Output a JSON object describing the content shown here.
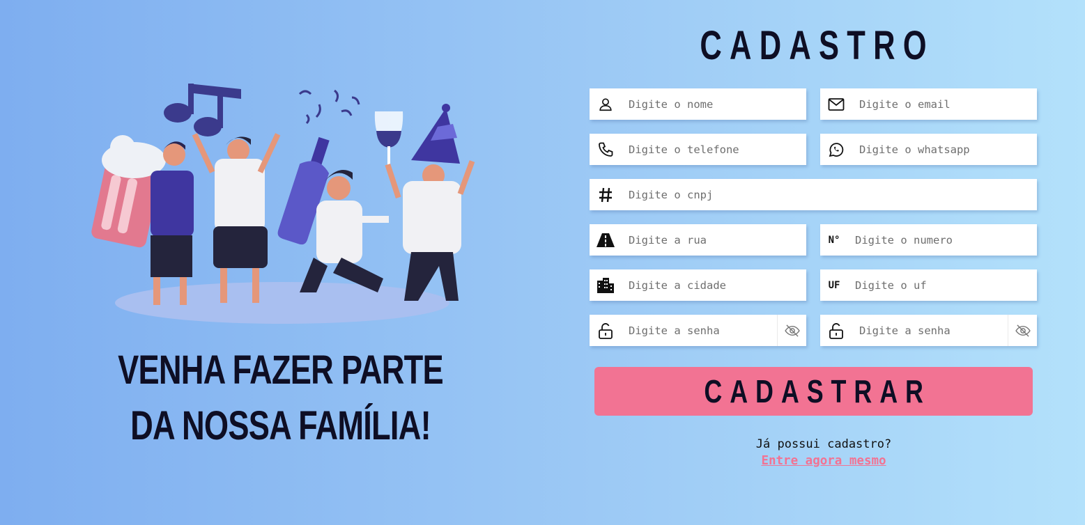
{
  "hero": {
    "tagline": "VENHA FAZER PARTE DA NOSSA FAMÍLIA!",
    "illustration_icon": "party-people-illustration"
  },
  "form": {
    "title": "CADASTRO",
    "fields": {
      "nome": {
        "placeholder": "Digite o nome",
        "icon": "user-icon"
      },
      "email": {
        "placeholder": "Digite o email",
        "icon": "mail-icon"
      },
      "telefone": {
        "placeholder": "Digite o telefone",
        "icon": "phone-icon"
      },
      "whatsapp": {
        "placeholder": "Digite o whatsapp",
        "icon": "whatsapp-icon"
      },
      "cnpj": {
        "placeholder": "Digite o cnpj",
        "icon": "hash-icon"
      },
      "rua": {
        "placeholder": "Digite a rua",
        "icon": "road-icon"
      },
      "numero": {
        "placeholder": "Digite o numero",
        "prefix": "N°"
      },
      "cidade": {
        "placeholder": "Digite a cidade",
        "icon": "city-icon"
      },
      "uf": {
        "placeholder": "Digite o uf",
        "prefix": "UF"
      },
      "senha": {
        "placeholder": "Digite a senha",
        "icon": "unlock-icon",
        "toggle_icon": "eye-off-icon"
      },
      "confirmar_senha": {
        "placeholder": "Digite a senha",
        "icon": "unlock-icon",
        "toggle_icon": "eye-off-icon"
      }
    },
    "submit_label": "CADASTRAR",
    "login_prompt": "Já possui cadastro?",
    "login_link": "Entre agora mesmo"
  },
  "colors": {
    "accent": "#f27393",
    "text_dark": "#0e0e24",
    "bg_left": "#7eaef0",
    "bg_right": "#b3e1fb"
  }
}
